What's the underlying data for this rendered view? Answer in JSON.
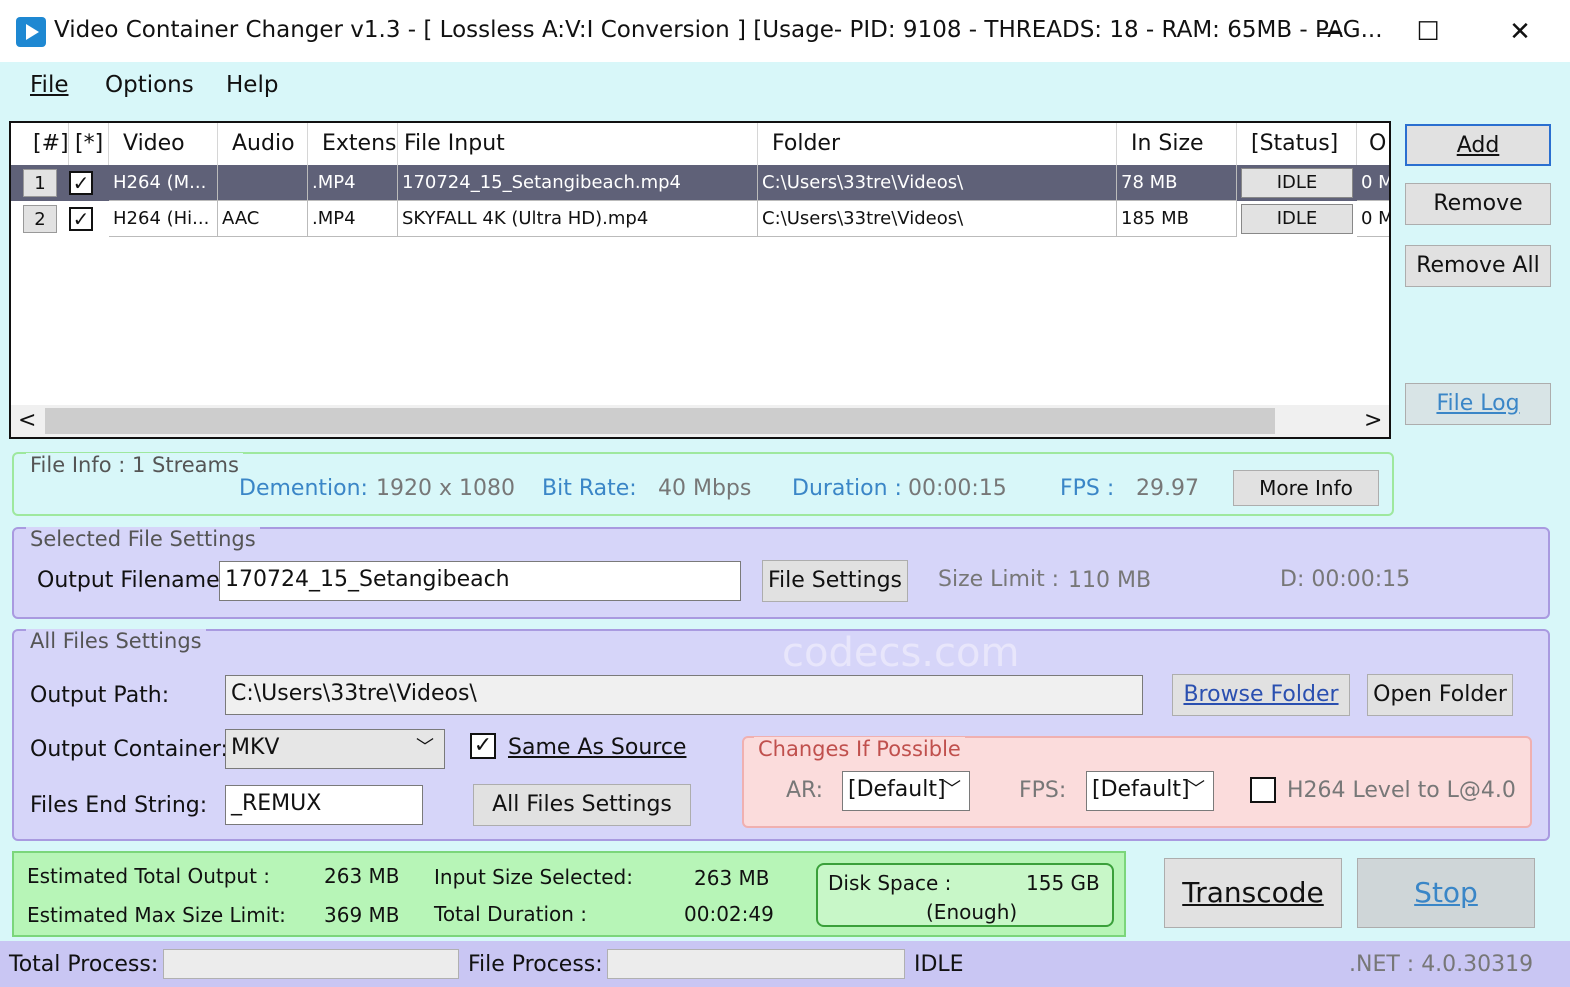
{
  "window": {
    "title": "Video Container Changer v1.3 - [ Lossless A:V:I Conversion ] [Usage- PID: 9108 - THREADS: 18 - RAM: 65MB - PAG...",
    "min_glyph": "—",
    "max_glyph": "☐",
    "close_glyph": "✕"
  },
  "menu": {
    "file": "File",
    "options": "Options",
    "help": "Help"
  },
  "grid": {
    "columns": [
      "[#]",
      "[*]",
      "Video",
      "Audio",
      "Extensic",
      "File Input",
      "Folder",
      "In Size",
      "[Status]",
      "O"
    ],
    "rows": [
      {
        "num": "1",
        "checked": "✓",
        "video": "H264 (M...",
        "audio": "",
        "ext": ".MP4",
        "input": "170724_15_Setangibeach.mp4",
        "folder": "C:\\Users\\33tre\\Videos\\",
        "size": "78 MB",
        "status": "IDLE",
        "out": "0 M"
      },
      {
        "num": "2",
        "checked": "✓",
        "video": "H264 (Hi...",
        "audio": "AAC",
        "ext": ".MP4",
        "input": "SKYFALL 4K (Ultra HD).mp4",
        "folder": "C:\\Users\\33tre\\Videos\\",
        "size": "185 MB",
        "status": "IDLE",
        "out": "0 M"
      }
    ],
    "scroll_left": "<",
    "scroll_right": ">"
  },
  "side": {
    "add": "Add",
    "remove": "Remove",
    "remove_all": "Remove All",
    "file_log": "File Log"
  },
  "file_info": {
    "legend": "File Info : 1 Streams",
    "dim_label": "Demention:",
    "dim_value": "1920 x 1080",
    "bitrate_label": "Bit Rate:",
    "bitrate_value": "40 Mbps",
    "duration_label": "Duration :",
    "duration_value": "00:00:15",
    "fps_label": "FPS :",
    "fps_value": "29.97",
    "more_info": "More Info"
  },
  "selected": {
    "legend": "Selected File Settings",
    "out_label": "Output Filename:",
    "out_value": "170724_15_Setangibeach",
    "file_settings": "File Settings",
    "size_limit_label": "Size Limit :",
    "size_limit_value": "110 MB",
    "d_value": "D: 00:00:15"
  },
  "all_files": {
    "legend": "All Files Settings",
    "path_label": "Output Path:",
    "path_value": "C:\\Users\\33tre\\Videos\\",
    "browse": "Browse Folder",
    "open": "Open Folder",
    "container_label": "Output Container:",
    "container_value": "MKV",
    "same_source": "Same As Source",
    "same_source_check": "✓",
    "end_label": "Files End String:",
    "end_value": "_REMUX",
    "all_settings": "All Files Settings",
    "watermark": "codecs.com"
  },
  "changes": {
    "legend": "Changes If Possible",
    "ar_label": "AR:",
    "ar_value": "[Default]",
    "fps_label": "FPS:",
    "fps_value": "[Default]",
    "h264": "H264 Level to L@4.0"
  },
  "summary": {
    "est_total_label": "Estimated Total Output :",
    "est_total_value": "263 MB",
    "est_max_label": "Estimated Max Size Limit:",
    "est_max_value": "369 MB",
    "input_sel_label": "Input Size Selected:",
    "input_sel_value": "263 MB",
    "total_dur_label": "Total Duration :",
    "total_dur_value": "00:02:49",
    "disk_label": "Disk Space :",
    "disk_value": "155 GB",
    "disk_status": "(Enough)"
  },
  "actions": {
    "transcode": "Transcode",
    "stop": "Stop"
  },
  "status": {
    "total_label": "Total Process:",
    "file_label": "File Process:",
    "state": "IDLE",
    "net": ".NET :  4.0.30319"
  },
  "colors": {
    "bg": "#d8f7f9",
    "selected_row": "#5f6178",
    "file_info_border": "#9ee89e",
    "purple_border": "#a99ae0",
    "changes_bg": "#fbdcdc",
    "summary_bg": "#b7f5b7",
    "statusbar": "#c9c6f3",
    "accent_text": "#3a86c7"
  }
}
